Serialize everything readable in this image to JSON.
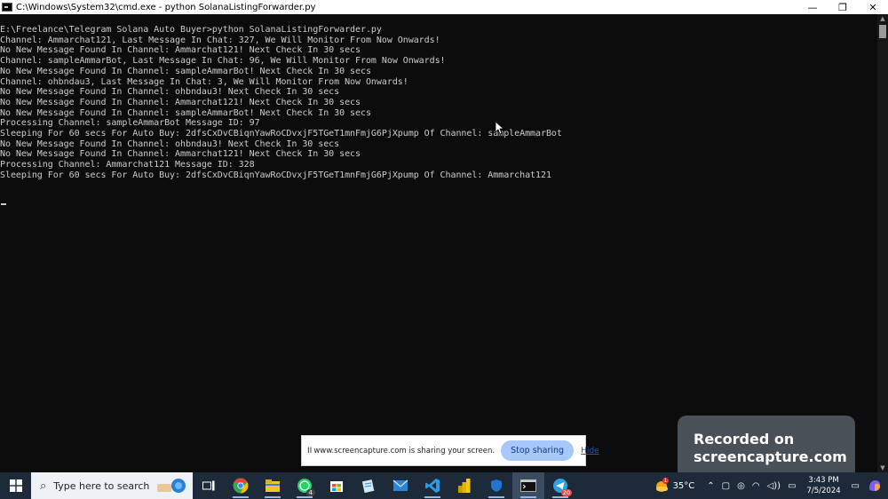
{
  "window": {
    "title": "C:\\Windows\\System32\\cmd.exe - python  SolanaListingForwarder.py",
    "minimize_glyph": "—",
    "restore_glyph": "❐",
    "close_glyph": "✕"
  },
  "console": {
    "lines": [
      "E:\\Freelance\\Telegram Solana Auto Buyer>python SolanaListingForwarder.py",
      "Channel: Ammarchat121, Last Message In Chat: 327, We Will Monitor From Now Onwards!",
      "No New Message Found In Channel: Ammarchat121! Next Check In 30 secs",
      "Channel: sampleAmmarBot, Last Message In Chat: 96, We Will Monitor From Now Onwards!",
      "No New Message Found In Channel: sampleAmmarBot! Next Check In 30 secs",
      "Channel: ohbndau3, Last Message In Chat: 3, We Will Monitor From Now Onwards!",
      "No New Message Found In Channel: ohbndau3! Next Check In 30 secs",
      "No New Message Found In Channel: Ammarchat121! Next Check In 30 secs",
      "No New Message Found In Channel: sampleAmmarBot! Next Check In 30 secs",
      "Processing Channel: sampleAmmarBot Message ID: 97",
      "Sleeping For 60 secs For Auto Buy: 2dfsCxDvCBiqnYawRoCDvxjF5TGeT1mnFmjG6PjXpump Of Channel: sampleAmmarBot",
      "No New Message Found In Channel: ohbndau3! Next Check In 30 secs",
      "No New Message Found In Channel: Ammarchat121! Next Check In 30 secs",
      "Processing Channel: Ammarchat121 Message ID: 328",
      "Sleeping For 60 secs For Auto Buy: 2dfsCxDvCBiqnYawRoCDvxjF5TGeT1mnFmjG6PjXpump Of Channel: Ammarchat121"
    ]
  },
  "share_bar": {
    "pause_glyph": "II",
    "message": "www.screencapture.com is sharing your screen.",
    "stop_label": "Stop sharing",
    "hide_label": "Hide"
  },
  "recorded_badge": {
    "line1": "Recorded on",
    "line2": "screencapture.com"
  },
  "taskbar": {
    "search_placeholder": "Type here to search",
    "whatsapp_badge": "4",
    "telegram_badge": "20",
    "weather_badge": "1",
    "temperature": "35°C",
    "time": "3:43 PM",
    "date": "7/5/2024",
    "colors": {
      "chrome_red": "#ea4335",
      "chrome_green": "#34a853",
      "chrome_yellow": "#fbbc05",
      "vscode_blue": "#2b9be8",
      "whatsapp_green": "#25d366",
      "telegram_blue": "#2aa3e0"
    }
  }
}
